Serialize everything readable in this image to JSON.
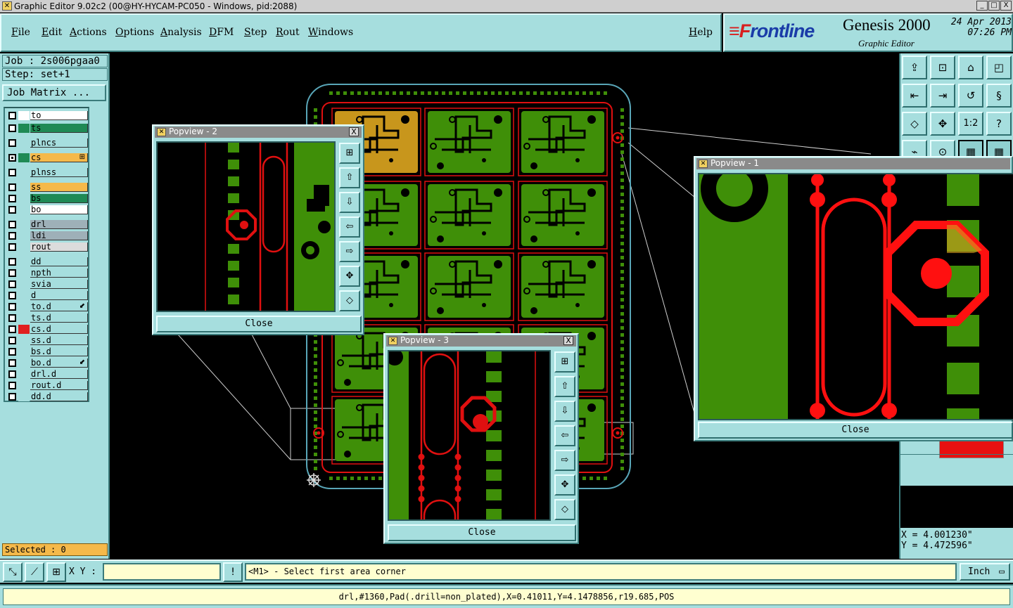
{
  "window": {
    "title": "Graphic Editor 9.02c2 (00@HY-HYCAM-PC050 - Windows, pid:2088)",
    "minimize": "_",
    "maximize": "□",
    "close": "X"
  },
  "menu": {
    "items": [
      "File",
      "Edit",
      "Actions",
      "Options",
      "Analysis",
      "DFM",
      "Step",
      "Rout",
      "Windows"
    ],
    "help": "Help"
  },
  "brand": {
    "logo_mark": "≡F",
    "logo_text": "rontline",
    "product": "Genesis 2000",
    "subtitle": "Graphic Editor",
    "date": "24 Apr 2013",
    "time": "07:26 PM"
  },
  "job": {
    "job_label": "Job : 2s006pgaa0",
    "step_label": "Step: set+1",
    "matrix_button": "Job Matrix ..."
  },
  "layers": [
    {
      "name": "to",
      "color": "#ffffff",
      "swatch": "#ffffff",
      "active": false
    },
    {
      "name": "ts",
      "color": "#1f8a55",
      "swatch": "#1f8a55",
      "active": false
    },
    {
      "name": "plncs",
      "color": "#a6dede",
      "swatch": "#a6dede",
      "active": false
    },
    {
      "name": "cs",
      "color": "#f5b94a",
      "swatch": "#1f8a55",
      "active": true,
      "mark": "⊞"
    },
    {
      "name": "plnss",
      "color": "#a6dede",
      "swatch": "#a6dede",
      "active": false
    },
    {
      "name": "ss",
      "color": "#f5b94a",
      "swatch": "#a6dede",
      "active": false
    },
    {
      "name": "bs",
      "color": "#1f8a55",
      "swatch": "#a6dede",
      "active": false
    },
    {
      "name": "bo",
      "color": "#ffffff",
      "swatch": "#a6dede",
      "active": false
    },
    {
      "name": "drl",
      "color": "#9eb0b8",
      "swatch": "#a6dede",
      "active": false
    },
    {
      "name": "ldi",
      "color": "#9eb0b8",
      "swatch": "#a6dede",
      "active": false
    },
    {
      "name": "rout",
      "color": "#dcdcdc",
      "swatch": "#a6dede",
      "active": false
    },
    {
      "name": "dd",
      "color": "#a6dede",
      "swatch": "#a6dede",
      "active": false
    },
    {
      "name": "npth",
      "color": "#a6dede",
      "swatch": "#a6dede",
      "active": false
    },
    {
      "name": "svia",
      "color": "#a6dede",
      "swatch": "#a6dede",
      "active": false
    },
    {
      "name": "d",
      "color": "#a6dede",
      "swatch": "#a6dede",
      "active": false
    },
    {
      "name": "to.d",
      "color": "#a6dede",
      "swatch": "#a6dede",
      "active": false,
      "mark": "⬋"
    },
    {
      "name": "ts.d",
      "color": "#a6dede",
      "swatch": "#a6dede",
      "active": false
    },
    {
      "name": "cs.d",
      "color": "#a6dede",
      "swatch": "#e02020",
      "active": false
    },
    {
      "name": "ss.d",
      "color": "#a6dede",
      "swatch": "#a6dede",
      "active": false
    },
    {
      "name": "bs.d",
      "color": "#a6dede",
      "swatch": "#a6dede",
      "active": false
    },
    {
      "name": "bo.d",
      "color": "#a6dede",
      "swatch": "#a6dede",
      "active": false,
      "mark": "⬋"
    },
    {
      "name": "drl.d",
      "color": "#a6dede",
      "swatch": "#a6dede",
      "active": false
    },
    {
      "name": "rout.d",
      "color": "#a6dede",
      "swatch": "#a6dede",
      "active": false
    },
    {
      "name": "dd.d",
      "color": "#a6dede",
      "swatch": "#a6dede",
      "active": false
    }
  ],
  "selected": "Selected : 0",
  "popups": [
    {
      "title": "Popview - 2",
      "close_label": "Close"
    },
    {
      "title": "Popview - 1",
      "close_label": "Close"
    },
    {
      "title": "Popview - 3",
      "close_label": "Close"
    }
  ],
  "coords": {
    "x": "X = 4.001230\"",
    "y": "Y = 4.472596\""
  },
  "bottom": {
    "xy_label": "X Y :",
    "xy_value": "",
    "alert": "!",
    "prompt": "<M1> - Select first area corner",
    "units": "Inch"
  },
  "status": "drl,#1360,Pad(.drill=non_plated),X=0.41011,Y=4.1478856,r19.685,POS",
  "colors": {
    "panel": "#a6dede",
    "copper_green": "#3f8f08",
    "selected_orange": "#c8961c",
    "drill_red": "#ff1010"
  }
}
